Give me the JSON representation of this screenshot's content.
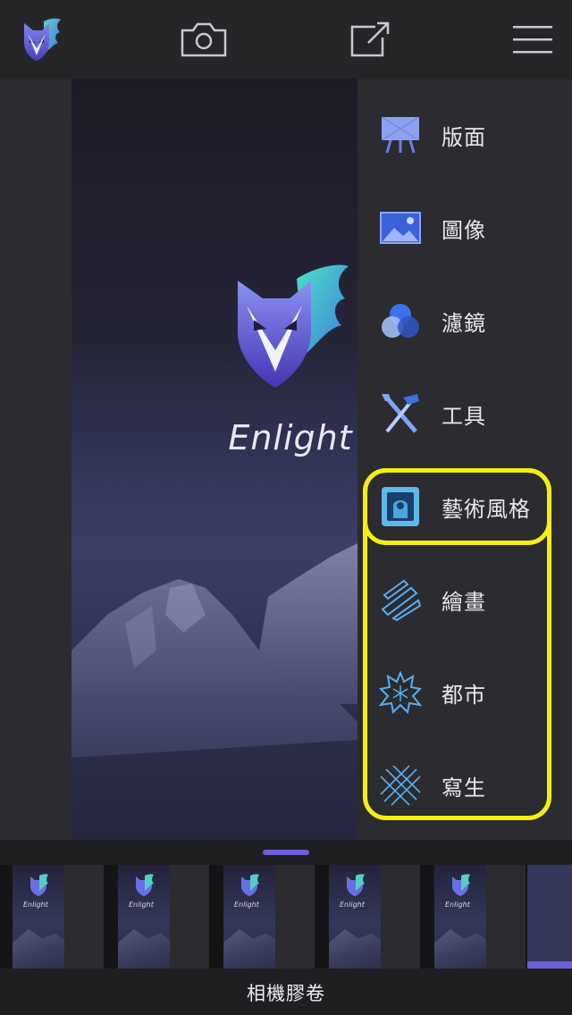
{
  "app": {
    "name": "Enlight",
    "accent_color": "#6c5fd8",
    "highlight_color": "#f5ef10"
  },
  "topbar": {
    "logo_icon": "enlight-fox-logo-icon",
    "camera_icon": "camera-icon",
    "share_icon": "share-export-icon",
    "menu_icon": "hamburger-menu-icon"
  },
  "canvas": {
    "splash_name": "Enlight"
  },
  "side_menu": {
    "items": [
      {
        "id": "layout",
        "label": "版面",
        "icon": "easel-icon"
      },
      {
        "id": "image",
        "label": "圖像",
        "icon": "image-icon"
      },
      {
        "id": "filters",
        "label": "濾鏡",
        "icon": "filters-circles-icon"
      },
      {
        "id": "tools",
        "label": "工具",
        "icon": "tools-icon"
      },
      {
        "id": "artistic",
        "label": "藝術風格",
        "icon": "portrait-frame-icon"
      },
      {
        "id": "painting",
        "label": "繪畫",
        "icon": "paint-strokes-icon"
      },
      {
        "id": "urban",
        "label": "都市",
        "icon": "splash-burst-icon"
      },
      {
        "id": "sketch",
        "label": "寫生",
        "icon": "crosshatch-icon"
      }
    ]
  },
  "bottom": {
    "camera_roll_label": "相機膠卷",
    "thumbnail_name": "Enlight"
  }
}
